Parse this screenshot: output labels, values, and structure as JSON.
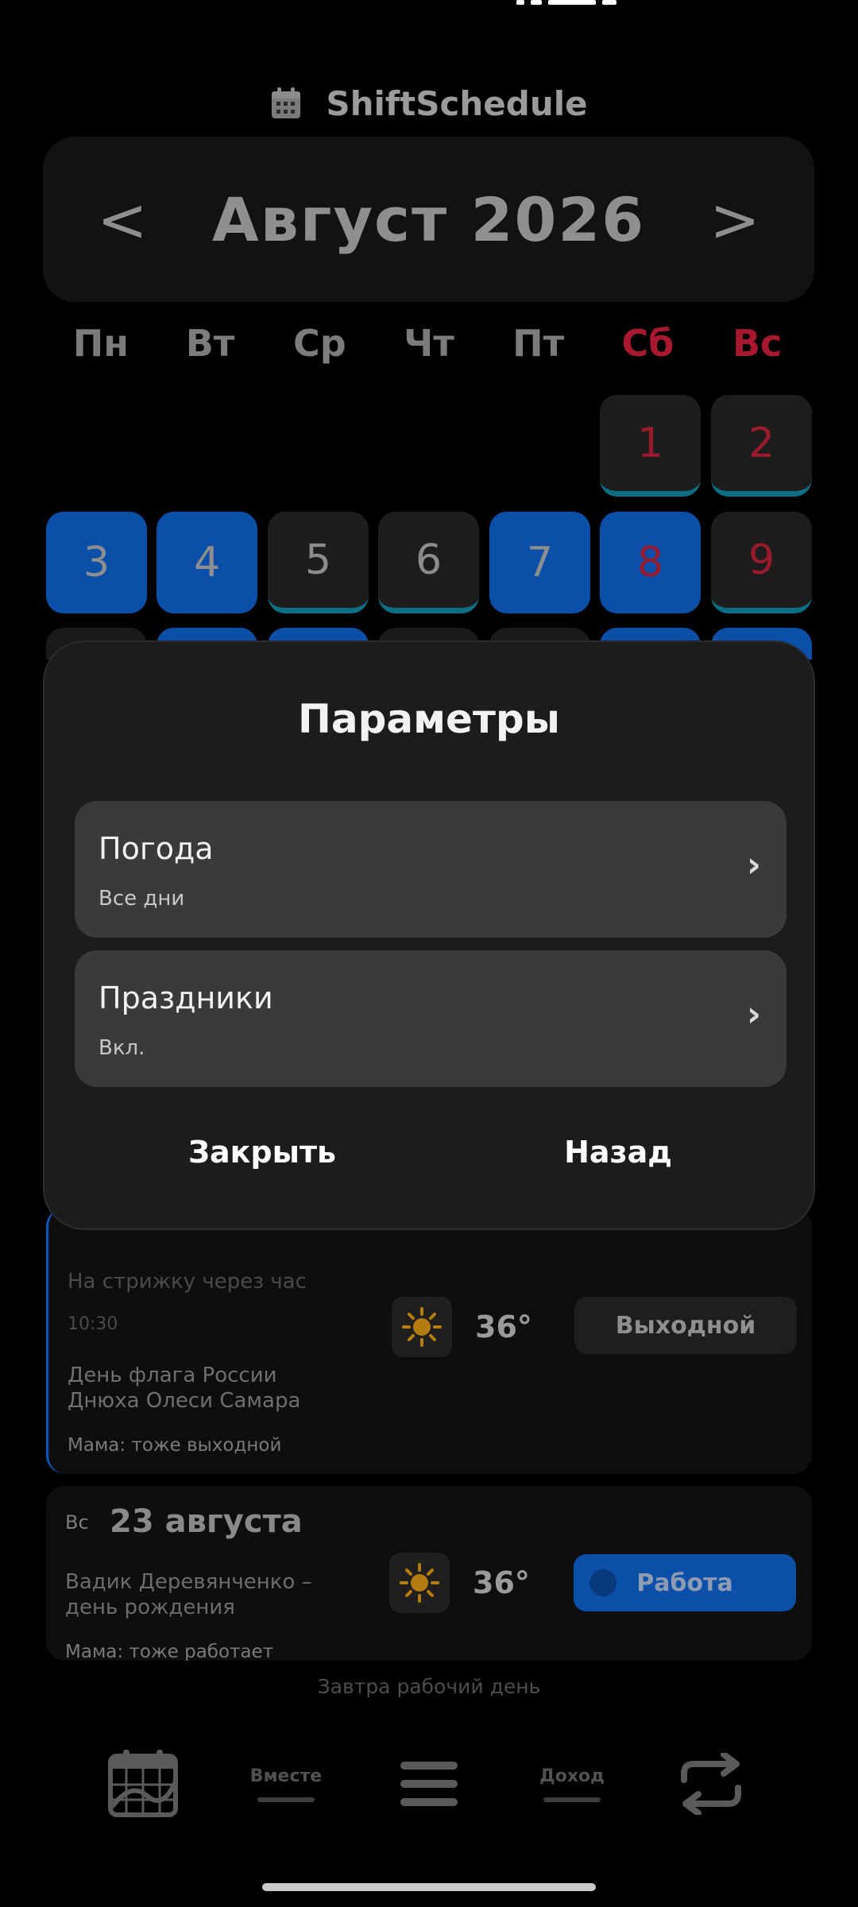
{
  "app": {
    "title": "ShiftSchedule"
  },
  "calendar": {
    "month_title": "Август 2026",
    "prev_label": "<",
    "next_label": ">",
    "weekdays": [
      "Пн",
      "Вт",
      "Ср",
      "Чт",
      "Пт",
      "Сб",
      "Вс"
    ],
    "weeks": [
      [
        "",
        "",
        "",
        "",
        "",
        "1",
        "2"
      ],
      [
        "3",
        "4",
        "5",
        "6",
        "7",
        "8",
        "9"
      ]
    ],
    "colors": {
      "work": "#0b4fa8",
      "weekend": "#a8192f",
      "off_marker": "#0d6f86"
    }
  },
  "day_cards": [
    {
      "note_line": "На стрижку через час",
      "time": "10:30",
      "events": [
        "День флага России",
        "Днюха Олеси Самара"
      ],
      "family_note": "Мама: тоже выходной",
      "weather_icon": "sun-icon",
      "temperature": "36°",
      "status": "Выходной"
    },
    {
      "weekday": "Вс",
      "date": "23 августа",
      "events": [
        "Вадик Деревянченко –",
        "день рождения"
      ],
      "family_note": "Мама: тоже работает",
      "weather_icon": "sun-icon",
      "temperature": "36°",
      "status": "Работа",
      "status_icon": "bell-icon"
    }
  ],
  "footer_hint": "Завтра рабочий день",
  "bottom_nav": {
    "calendar_icon": "calendar-chart-icon",
    "together": "Вместе",
    "menu_icon": "menu-icon",
    "income": "Доход",
    "sync_icon": "sync-icon"
  },
  "dialog": {
    "title": "Параметры",
    "rows": [
      {
        "title": "Погода",
        "subtitle": "Все дни",
        "chevron": "›"
      },
      {
        "title": "Праздники",
        "subtitle": "Вкл.",
        "chevron": "›"
      }
    ],
    "close_label": "Закрыть",
    "back_label": "Назад"
  }
}
